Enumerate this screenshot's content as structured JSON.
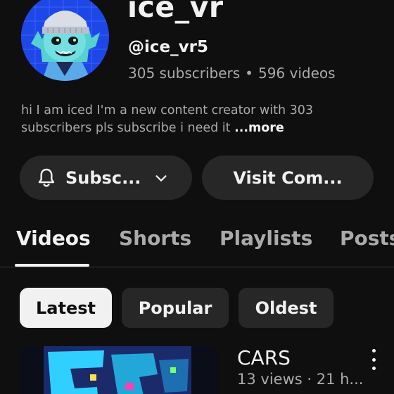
{
  "channel": {
    "name": "ice_vr",
    "handle": "@ice_vr5",
    "subscribers": "305 subscribers",
    "separator": "•",
    "videos_count": "596 videos",
    "bio_text": "hi I am iced  I'm a new content creator with 303 subscribers pls subscribe i need it ",
    "bio_more": "...more",
    "avatar": "cartoon-avatar-blue-hair-beanie"
  },
  "actions": {
    "subscribe_label": "Subsc...",
    "visit_label": "Visit Com...",
    "subscribe_icon": "bell-icon",
    "dropdown_icon": "chevron-down-icon"
  },
  "tabs": {
    "videos": "Videos",
    "shorts": "Shorts",
    "playlists": "Playlists",
    "posts": "Posts",
    "active": "Videos"
  },
  "filters": {
    "latest": "Latest",
    "popular": "Popular",
    "oldest": "Oldest",
    "active": "Latest"
  },
  "video": {
    "title": "CARS",
    "meta": "13 views · 21 h..."
  },
  "colors": {
    "background": "#0f0f0f",
    "surface": "#272727",
    "text_primary": "#f1f1f1",
    "text_secondary": "#aaaaaa"
  }
}
